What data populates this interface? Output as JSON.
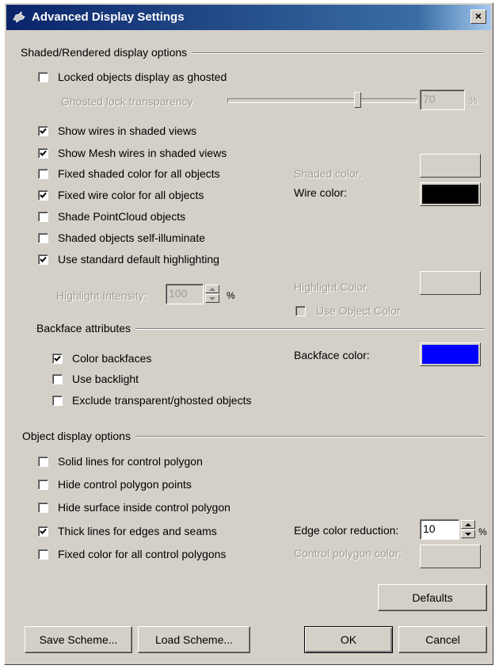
{
  "window": {
    "title": "Advanced Display Settings",
    "close_glyph": "×"
  },
  "shaded": {
    "group_title": "Shaded/Rendered display options",
    "locked_ghosted": {
      "label": "Locked objects display as ghosted",
      "checked": false
    },
    "ghosted_transparency": {
      "label": "Ghosted lock transparency",
      "value": "70",
      "unit": "%",
      "level": 0.7
    },
    "show_wires": {
      "label": "Show wires in shaded views",
      "checked": true
    },
    "show_mesh_wires": {
      "label": "Show Mesh wires in shaded views",
      "checked": true
    },
    "fixed_shaded_color": {
      "label": "Fixed shaded color for all objects",
      "checked": false
    },
    "fixed_wire_color": {
      "label": "Fixed wire color for all objects",
      "checked": true
    },
    "shade_pointcloud": {
      "label": "Shade PointCloud objects",
      "checked": false
    },
    "self_illuminate": {
      "label": "Shaded objects self-illuminate",
      "checked": false
    },
    "standard_highlighting": {
      "label": "Use standard default highlighting",
      "checked": true
    },
    "shaded_color_label": "Shaded color:",
    "wire_color_label": "Wire color:",
    "wire_color": "#000000",
    "highlight_intensity": {
      "label": "Highlight Intensity:",
      "value": "100",
      "unit": "%"
    },
    "highlight_color_label": "Highlight Color:",
    "use_object_color": {
      "label": "Use Object Color",
      "checked": false
    }
  },
  "backface": {
    "group_title": "Backface attributes",
    "color_backfaces": {
      "label": "Color backfaces",
      "checked": true
    },
    "use_backlight": {
      "label": "Use backlight",
      "checked": false
    },
    "exclude_transparent": {
      "label": "Exclude transparent/ghosted objects",
      "checked": false
    },
    "backface_color_label": "Backface color:",
    "backface_color": "#0000ff"
  },
  "object_display": {
    "group_title": "Object display options",
    "solid_lines": {
      "label": "Solid lines for control polygon",
      "checked": false
    },
    "hide_points": {
      "label": "Hide control polygon points",
      "checked": false
    },
    "hide_surface": {
      "label": "Hide surface inside control polygon",
      "checked": false
    },
    "thick_lines": {
      "label": "Thick lines for edges and seams",
      "checked": true
    },
    "fixed_polygon_color": {
      "label": "Fixed color for all control polygons",
      "checked": false
    },
    "edge_reduction": {
      "label": "Edge color reduction:",
      "value": "10",
      "unit": "%"
    },
    "control_polygon_color_label": "Control polygon color:"
  },
  "buttons": {
    "defaults": "Defaults",
    "save_scheme": "Save Scheme...",
    "load_scheme": "Load Scheme...",
    "ok": "OK",
    "cancel": "Cancel"
  }
}
